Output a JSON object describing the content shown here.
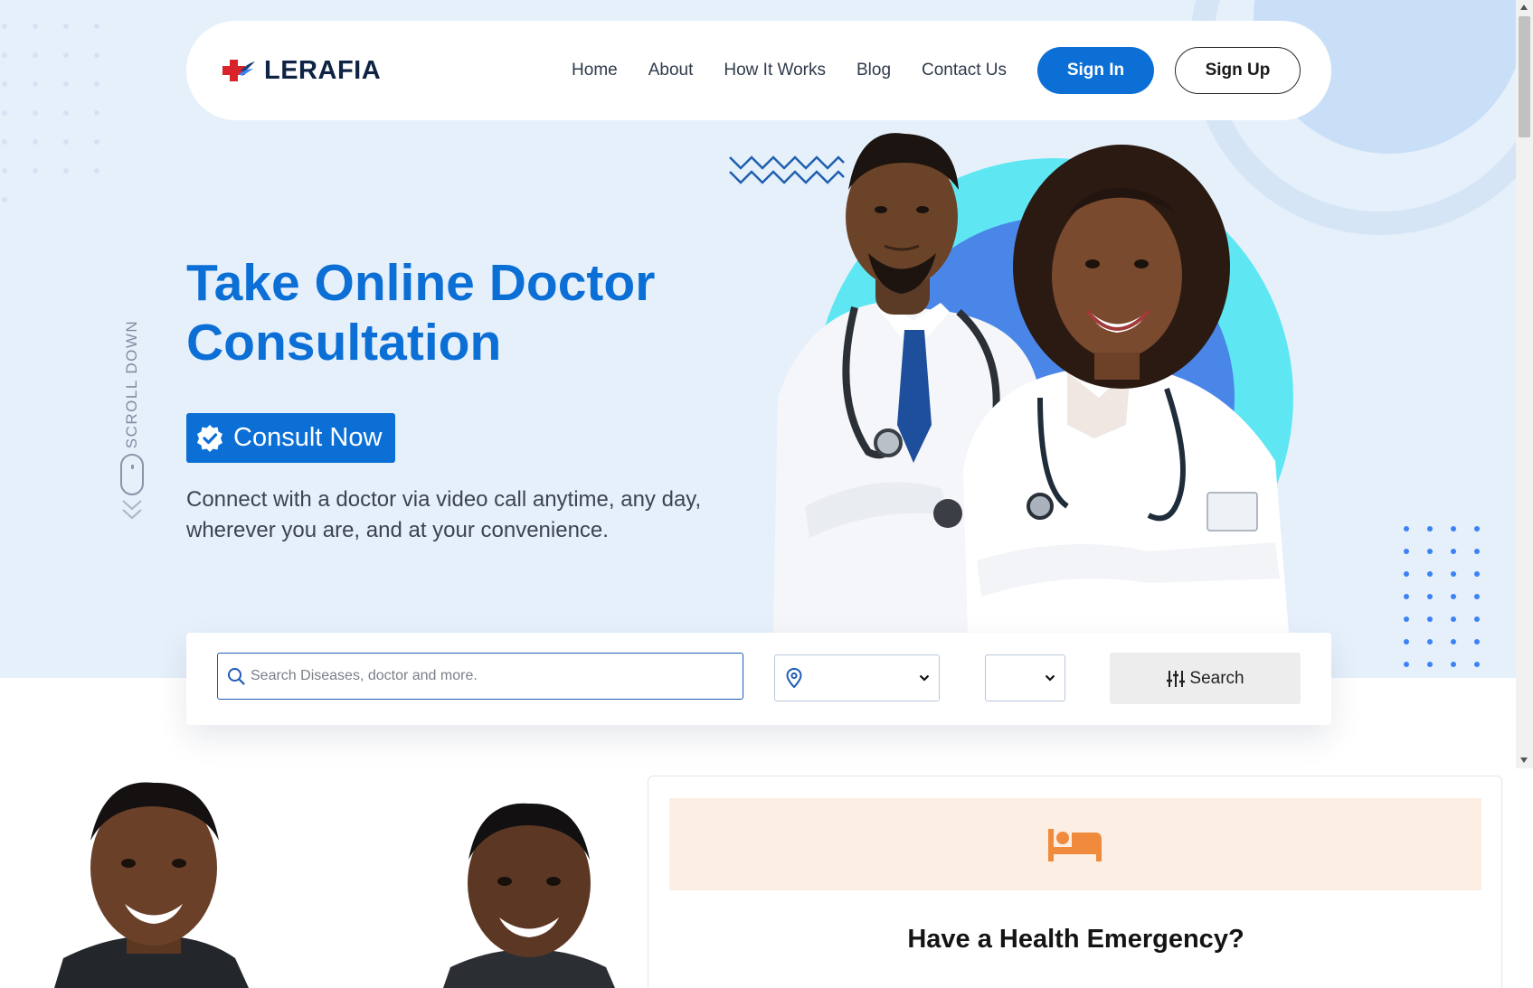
{
  "brand": {
    "name": "LERAFIA",
    "logo_icon": "medical-cross-icon"
  },
  "nav": {
    "links": [
      "Home",
      "About",
      "How It Works",
      "Blog",
      "Contact Us"
    ],
    "signin_label": "Sign In",
    "signup_label": "Sign Up"
  },
  "hero": {
    "title": "Take Online Doctor Consultation",
    "cta_label": "Consult Now",
    "cta_icon": "verified-badge-icon",
    "description": "Connect with a doctor via video call anytime, any day, wherever you are, and at your convenience.",
    "scroll_label": "SCROLL DOWN"
  },
  "search": {
    "placeholder": "Search Diseases, doctor and more.",
    "value": "",
    "location_value": "",
    "second_select_value": "",
    "button_label": "Search",
    "button_icon": "sliders-icon"
  },
  "emergency": {
    "title": "Have a Health Emergency?",
    "icon": "bed-icon"
  },
  "colors": {
    "primary": "#0b6fd6",
    "hero_bg": "#e6f0fb",
    "brand_red": "#d8232a",
    "brand_navy": "#0f2444",
    "emergency_accent": "#f08a3c",
    "emergency_bg": "#fdeee3"
  }
}
